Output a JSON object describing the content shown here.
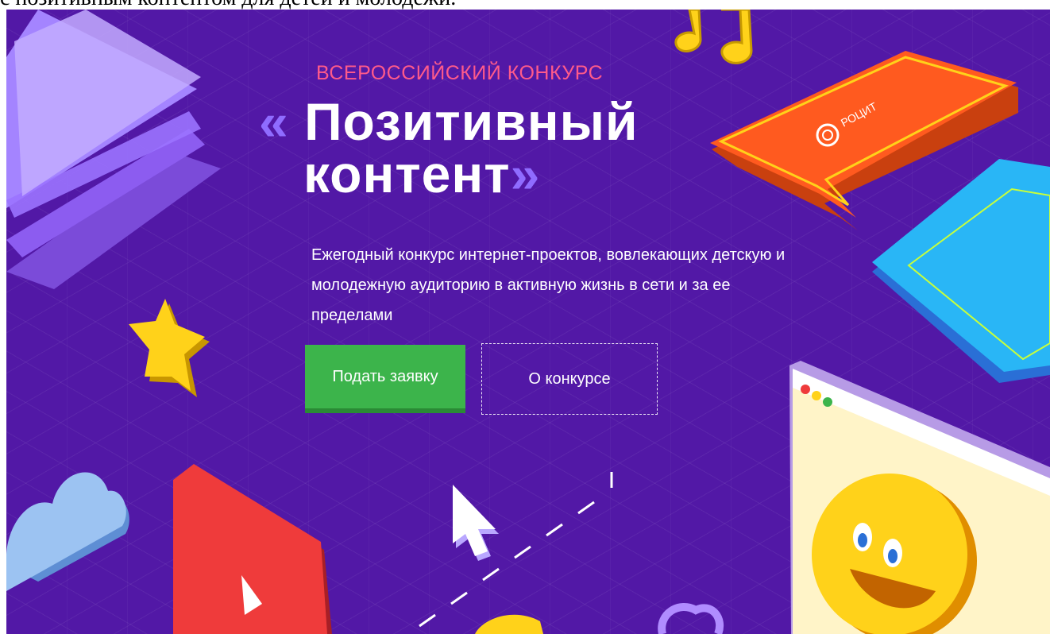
{
  "top_strip": {
    "text": "с позитивным контентом для детей и молодежи."
  },
  "hero": {
    "eyebrow": "ВСЕРОССИЙСКИЙ КОНКУРС",
    "title_open_quote": "«",
    "title_line1": "Позитивный",
    "title_line2": "контент",
    "title_close_quote": "»",
    "description": "Ежегодный конкурс интернет-проектов, вовлекающих детскую и молодежную аудиторию в активную жизнь в сети и за ее пределами",
    "apply_button": "Подать заявку",
    "about_button": "О конкурсе",
    "bubble_logo_text": "РОЦИТ"
  },
  "colors": {
    "background": "#5218a6",
    "eyebrow": "#ff5a8a",
    "quote_marks": "#8f6cff",
    "primary_button": "#3cb44b",
    "bubble": "#ff5a1f",
    "tablet": "#29b6f6",
    "video_tile": "#ef3b3b",
    "star": "#ffd21a",
    "browser_window": "#fff4c8",
    "smiley": "#ffd21a"
  },
  "icons": [
    "star-icon",
    "cloud-icon",
    "play-icon",
    "cursor-icon",
    "music-note-icon",
    "speech-bubble-icon",
    "smiley-icon"
  ]
}
